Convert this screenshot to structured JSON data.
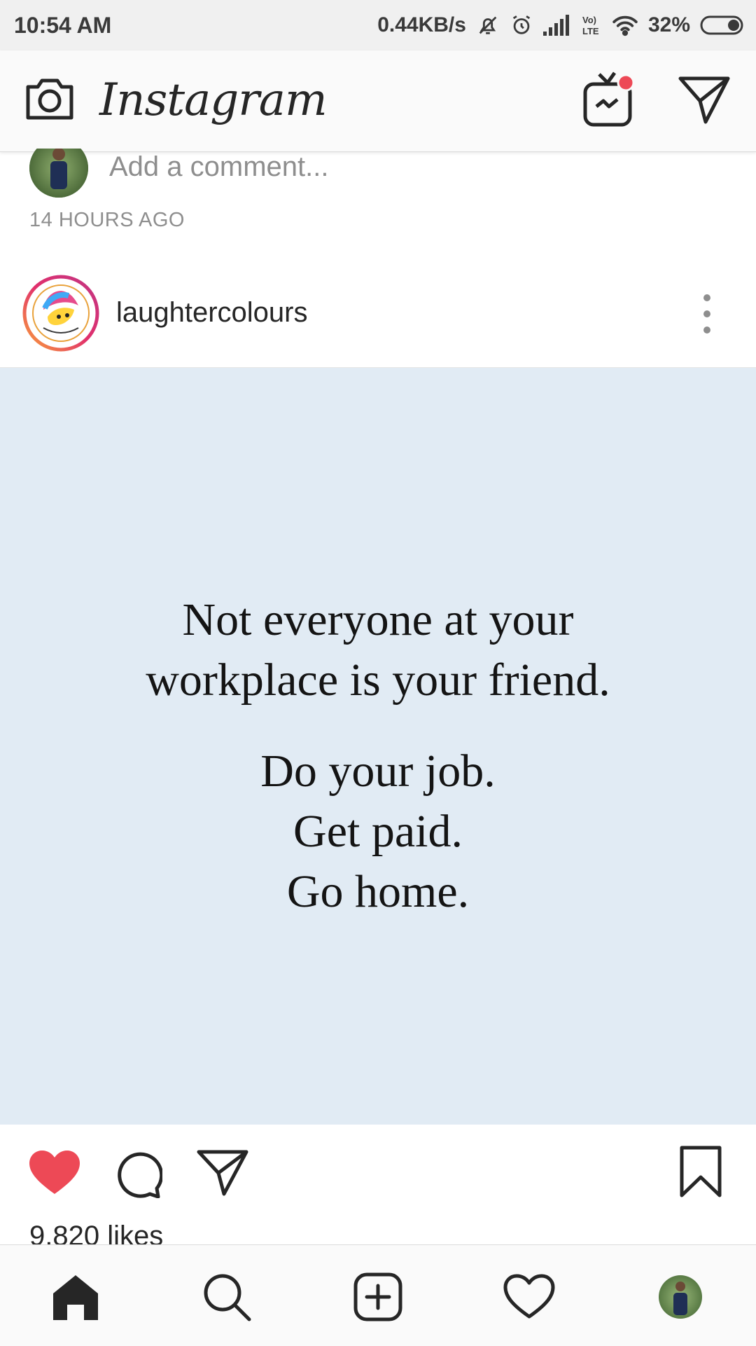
{
  "status_bar": {
    "time": "10:54 AM",
    "network_speed": "0.44KB/s",
    "battery_percent": "32%",
    "icons": [
      "mute-icon",
      "alarm-icon",
      "signal-icon",
      "volte-icon",
      "wifi-icon",
      "battery-icon"
    ]
  },
  "header": {
    "brand": "Instagram",
    "icons": [
      "camera-icon",
      "igtv-icon",
      "direct-message-icon"
    ],
    "notification_dot_color": "#ed4956"
  },
  "previous_post": {
    "comment_placeholder": "Add a comment...",
    "time_ago": "14 HOURS AGO"
  },
  "post": {
    "username": "laughtercolours",
    "quote_lines": [
      "Not everyone at your",
      "workplace is your friend.",
      "Do your job.",
      "Get paid.",
      "Go home."
    ],
    "image_background": "#e1ebf4",
    "liked": true,
    "like_color": "#ed4956",
    "likes_text": "9,820 likes"
  },
  "bottom_nav": {
    "items": [
      "home-icon",
      "search-icon",
      "new-post-icon",
      "activity-icon",
      "profile-avatar"
    ]
  }
}
